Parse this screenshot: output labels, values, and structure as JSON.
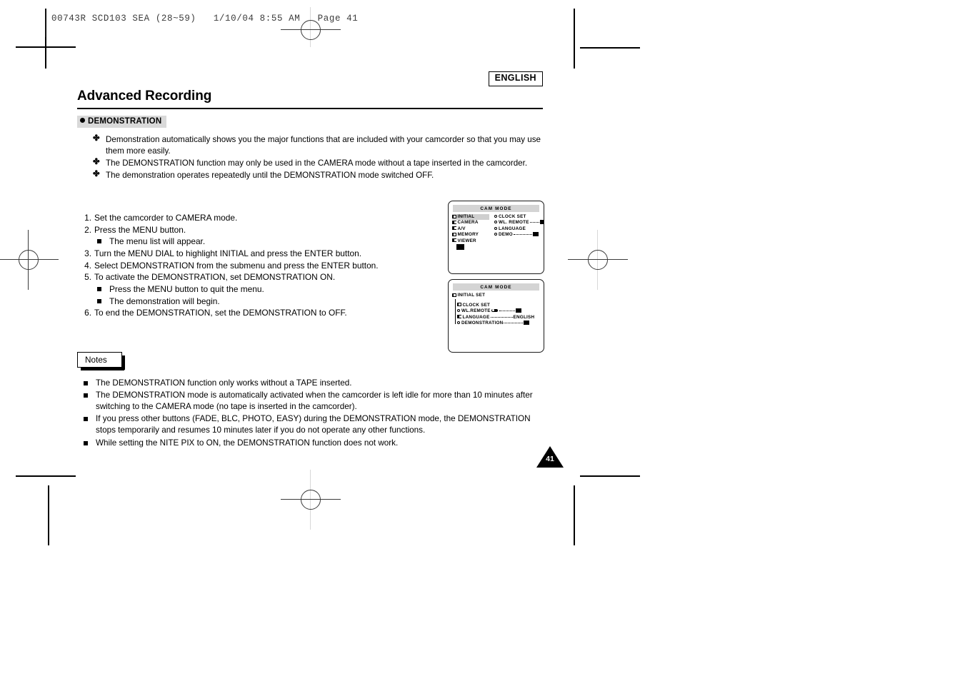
{
  "print_slug": "00743R SCD103 SEA (28~59)   1/10/04 8:55 AM   Page 41",
  "language_badge": "ENGLISH",
  "page_title": "Advanced Recording",
  "section": {
    "heading": "DEMONSTRATION",
    "intro_bullets": [
      "Demonstration automatically shows you the major functions that are included with your camcorder so that you may use them more easily.",
      "The DEMONSTRATION function may only be used in the CAMERA mode without a tape inserted in the camcorder.",
      "The demonstration operates repeatedly until the DEMONSTRATION mode switched OFF."
    ]
  },
  "steps": [
    {
      "num": "1.",
      "text": "Set the camcorder to CAMERA mode.",
      "sub": []
    },
    {
      "num": "2.",
      "text": "Press the MENU button.",
      "sub": [
        "The menu list will appear."
      ]
    },
    {
      "num": "3.",
      "text": "Turn the MENU DIAL to highlight INITIAL and press the ENTER button.",
      "sub": []
    },
    {
      "num": "4.",
      "text": "Select DEMONSTRATION from the submenu and press the ENTER button.",
      "sub": []
    },
    {
      "num": "5.",
      "text": "To activate the DEMONSTRATION, set DEMONSTRATION ON.",
      "sub": [
        "Press the MENU button to quit the menu.",
        "The demonstration will begin."
      ]
    },
    {
      "num": "6.",
      "text": "To end the DEMONSTRATION, set the DEMONSTRATION to OFF.",
      "sub": []
    }
  ],
  "notes": {
    "label": "Notes",
    "items": [
      "The DEMONSTRATION function only works without a TAPE inserted.",
      "The DEMONSTRATION mode is automatically activated when the camcorder is left idle for more than 10 minutes after switching to the CAMERA mode (no tape is inserted in the camcorder).",
      "If you press other buttons (FADE, BLC, PHOTO, EASY) during the DEMONSTRATION mode, the DEMONSTRATION stops temporarily and resumes 10 minutes later if you do not operate any other functions.",
      "While setting the NITE PIX to ON, the DEMONSTRATION function does not work."
    ]
  },
  "lcd_screen_1": {
    "title": "CAM MODE",
    "main_menu": [
      {
        "label": "INITIAL",
        "highlighted": true
      },
      {
        "label": "CAMERA",
        "highlighted": false
      },
      {
        "label": "A/V",
        "highlighted": false
      },
      {
        "label": "MEMORY",
        "highlighted": false
      },
      {
        "label": "VIEWER",
        "highlighted": false
      }
    ],
    "sub_menu": [
      {
        "label": "CLOCK  SET",
        "value": ""
      },
      {
        "label": "WL. REMOTE",
        "value": "swatch"
      },
      {
        "label": "LANGUAGE",
        "value": ""
      },
      {
        "label": "DEMO",
        "value": "swatch"
      }
    ]
  },
  "lcd_screen_2": {
    "title": "CAM MODE",
    "root": "INITIAL SET",
    "items": [
      {
        "label": "CLOCK  SET",
        "value": "",
        "icon": "folder"
      },
      {
        "label": "WL.REMOTE",
        "value": "swatch",
        "icon": "dot",
        "toggle": true
      },
      {
        "label": "LANGUAGE",
        "value": "ENGLISH",
        "icon": "folder"
      },
      {
        "label": "DEMONSTRATION",
        "value": "swatch",
        "icon": "dot"
      }
    ]
  },
  "page_number": "41"
}
